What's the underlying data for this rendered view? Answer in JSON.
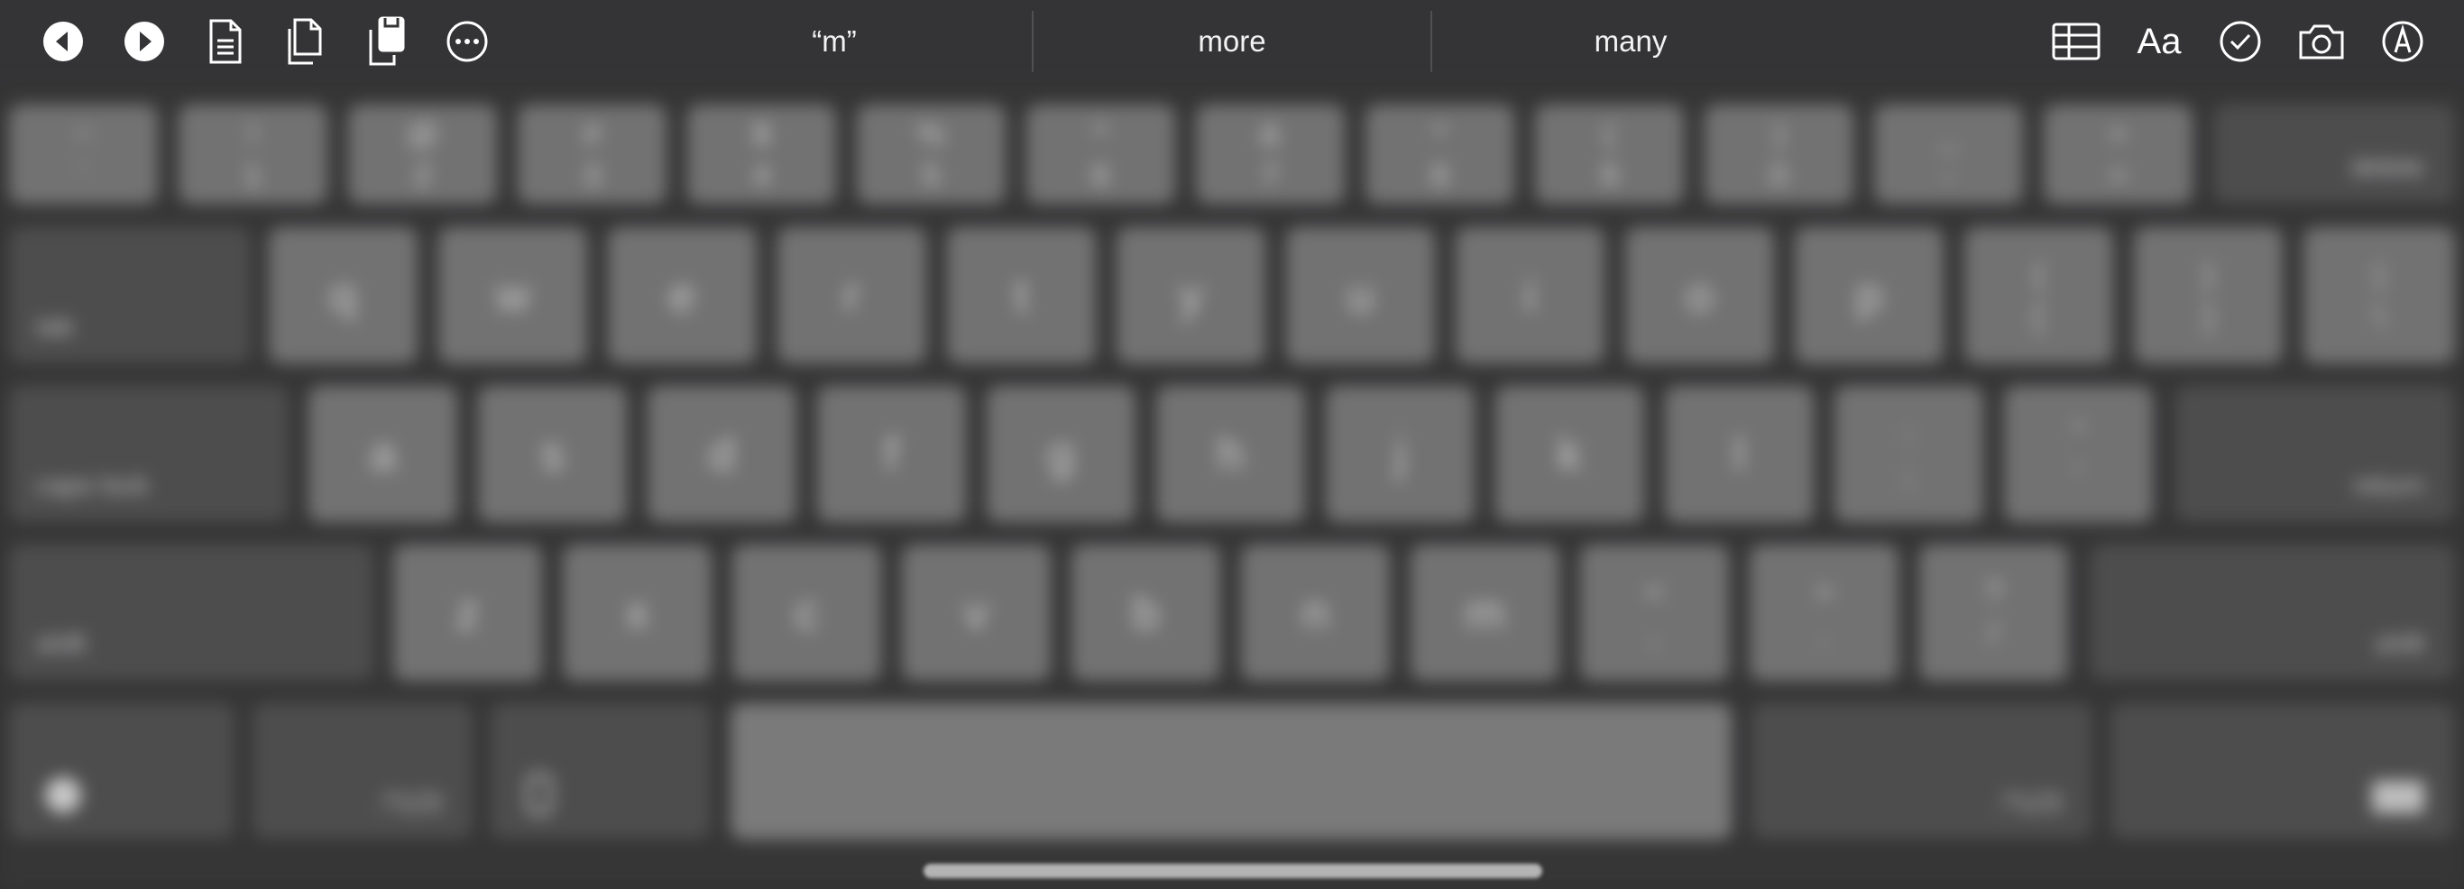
{
  "toolbar": {
    "left_icons": [
      "undo-icon",
      "redo-icon",
      "paste-icon",
      "copy-icon",
      "clipboard-icon",
      "more-options-icon"
    ],
    "suggestions": [
      "“m”",
      "more",
      "many"
    ],
    "right_icons": [
      "table-icon",
      "format-text-icon",
      "checklist-icon",
      "camera-icon",
      "markup-icon"
    ],
    "format_label": "Aa"
  },
  "keyboard": {
    "row1": [
      {
        "top": "~",
        "bottom": "`"
      },
      {
        "top": "!",
        "bottom": "1"
      },
      {
        "top": "@",
        "bottom": "2"
      },
      {
        "top": "#",
        "bottom": "3"
      },
      {
        "top": "$",
        "bottom": "4"
      },
      {
        "top": "%",
        "bottom": "5"
      },
      {
        "top": "^",
        "bottom": "6"
      },
      {
        "top": "&",
        "bottom": "7"
      },
      {
        "top": "*",
        "bottom": "8"
      },
      {
        "top": "(",
        "bottom": "9"
      },
      {
        "top": ")",
        "bottom": "0"
      },
      {
        "top": "_",
        "bottom": "-"
      },
      {
        "top": "+",
        "bottom": "="
      }
    ],
    "delete": "delete",
    "tab": "tab",
    "row2": [
      "q",
      "w",
      "e",
      "r",
      "t",
      "y",
      "u",
      "i",
      "o",
      "p"
    ],
    "row2_sym": [
      {
        "top": "{",
        "bottom": "["
      },
      {
        "top": "}",
        "bottom": "]"
      },
      {
        "top": "|",
        "bottom": "\\"
      }
    ],
    "caps_lock": "caps lock",
    "row3": [
      "a",
      "s",
      "d",
      "f",
      "g",
      "h",
      "j",
      "k",
      "l"
    ],
    "row3_sym": [
      {
        "top": ":",
        "bottom": ";"
      },
      {
        "top": "\"",
        "bottom": "'"
      }
    ],
    "return": "return",
    "shift_left": "shift",
    "row4": [
      "z",
      "x",
      "c",
      "v",
      "b",
      "n",
      "m"
    ],
    "row4_sym": [
      {
        "top": "<",
        "bottom": ","
      },
      {
        "top": ">",
        "bottom": "."
      },
      {
        "top": "?",
        "bottom": "/"
      }
    ],
    "shift_right": "shift",
    "emoji": "emoji-icon",
    "numbers_left": ".?123",
    "mic": "microphone-icon",
    "space": "",
    "numbers_right": ".?123",
    "hide_keyboard": "hide-keyboard-icon"
  },
  "colors": {
    "toolbar_bg": "#343436",
    "key": "#727272",
    "modifier_key": "#4d4d4e",
    "icon": "#ffffff"
  }
}
